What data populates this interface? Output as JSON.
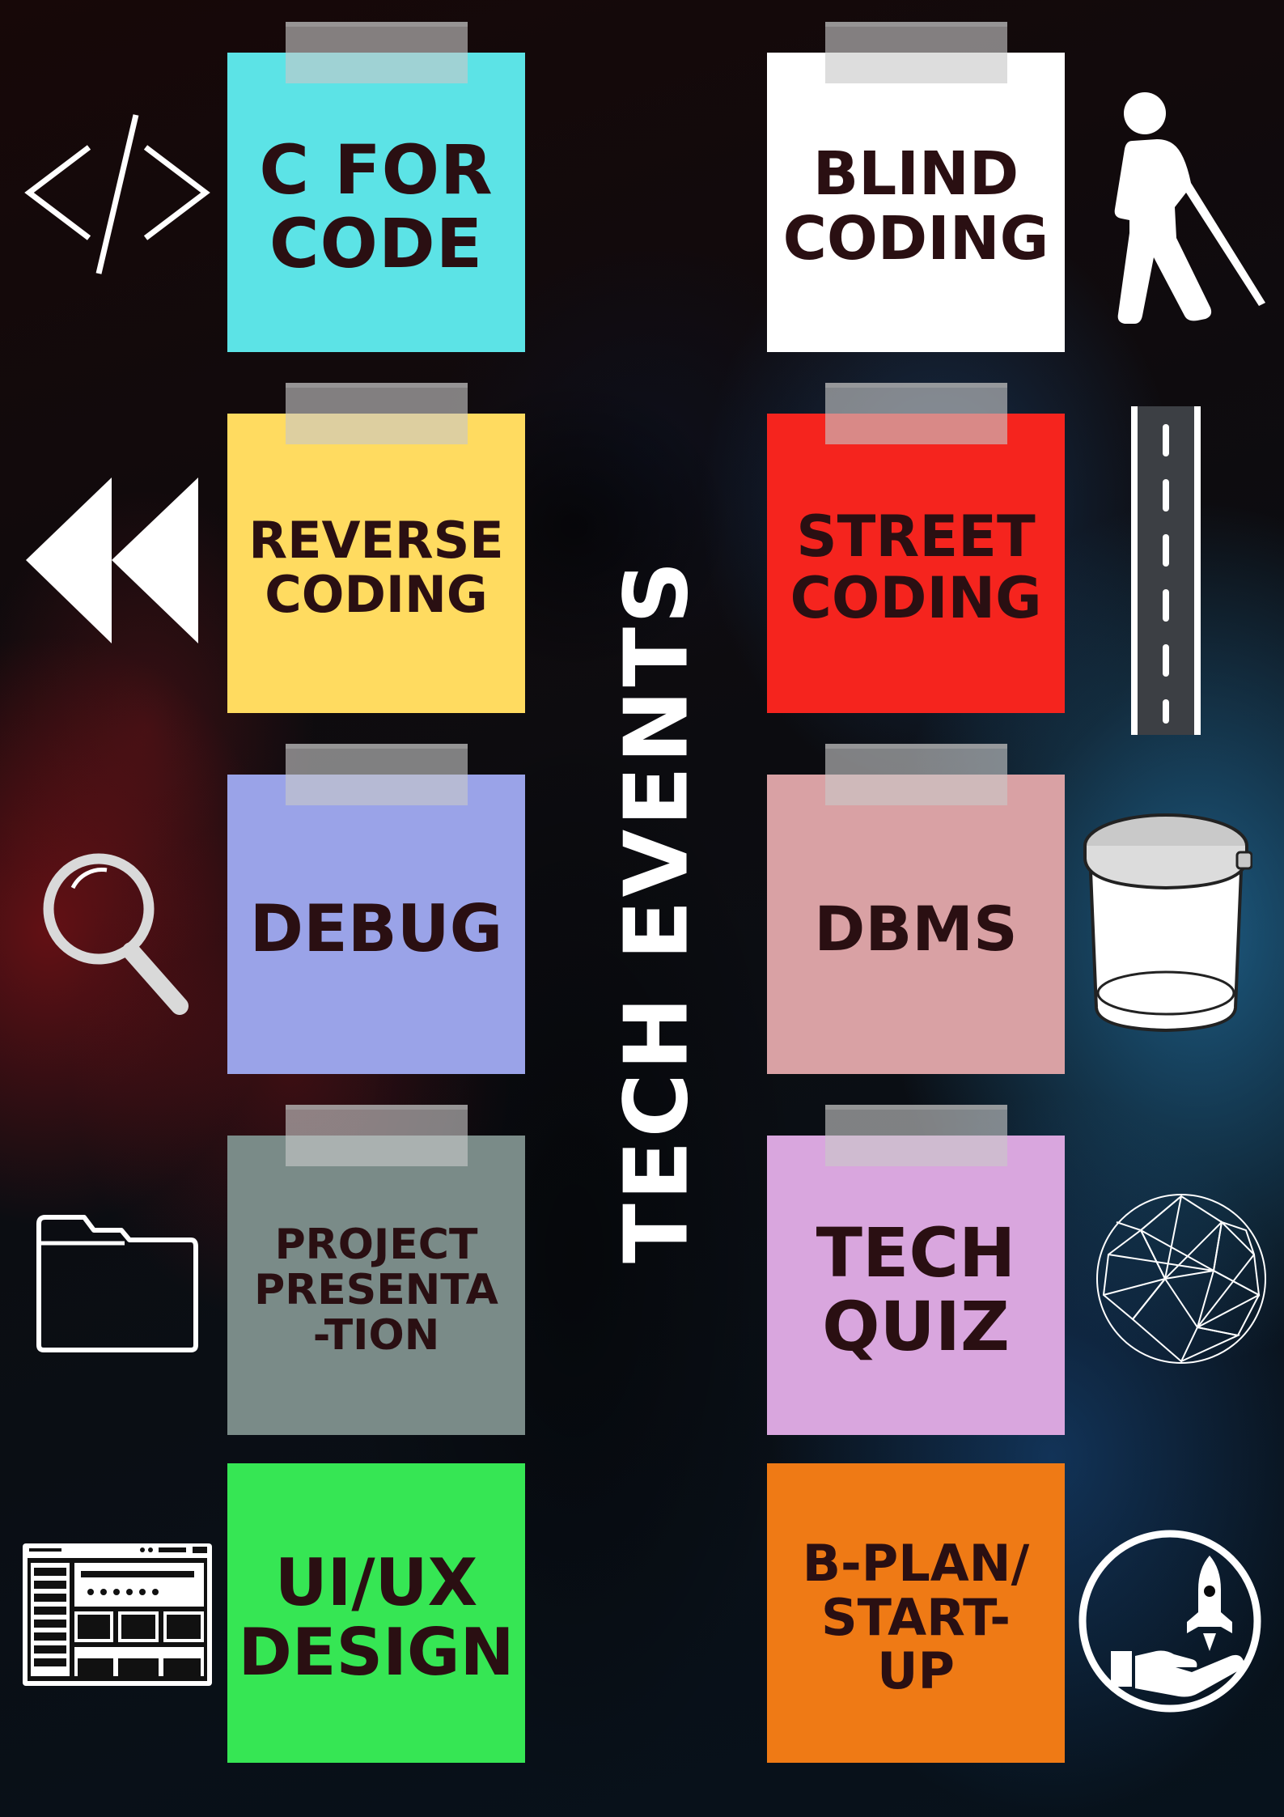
{
  "title": "TECH EVENTS",
  "events": [
    {
      "label": "C FOR\nCODE",
      "color": "#5ce3e6",
      "icon": "code-icon"
    },
    {
      "label": "BLIND\nCODING",
      "color": "#ffffff",
      "icon": "blind-person-icon"
    },
    {
      "label": "REVERSE\nCODING",
      "color": "#ffdb60",
      "icon": "rewind-icon"
    },
    {
      "label": "STREET\nCODING",
      "color": "#f5241e",
      "icon": "road-icon"
    },
    {
      "label": "DEBUG",
      "color": "#9aa3e8",
      "icon": "magnifier-icon"
    },
    {
      "label": "DBMS",
      "color": "#d9a1a4",
      "icon": "database-icon"
    },
    {
      "label": "PROJECT\nPRESENTA\n-TION",
      "color": "#7a8b88",
      "icon": "folder-icon"
    },
    {
      "label": "TECH\nQUIZ",
      "color": "#d9a6de",
      "icon": "geodesic-sphere-icon"
    },
    {
      "label": "UI/UX\nDESIGN",
      "color": "#36e654",
      "icon": "wireframe-icon"
    },
    {
      "label": "B-PLAN/\nSTART-\nUP",
      "color": "#ef7a15",
      "icon": "rocket-hand-icon"
    }
  ]
}
